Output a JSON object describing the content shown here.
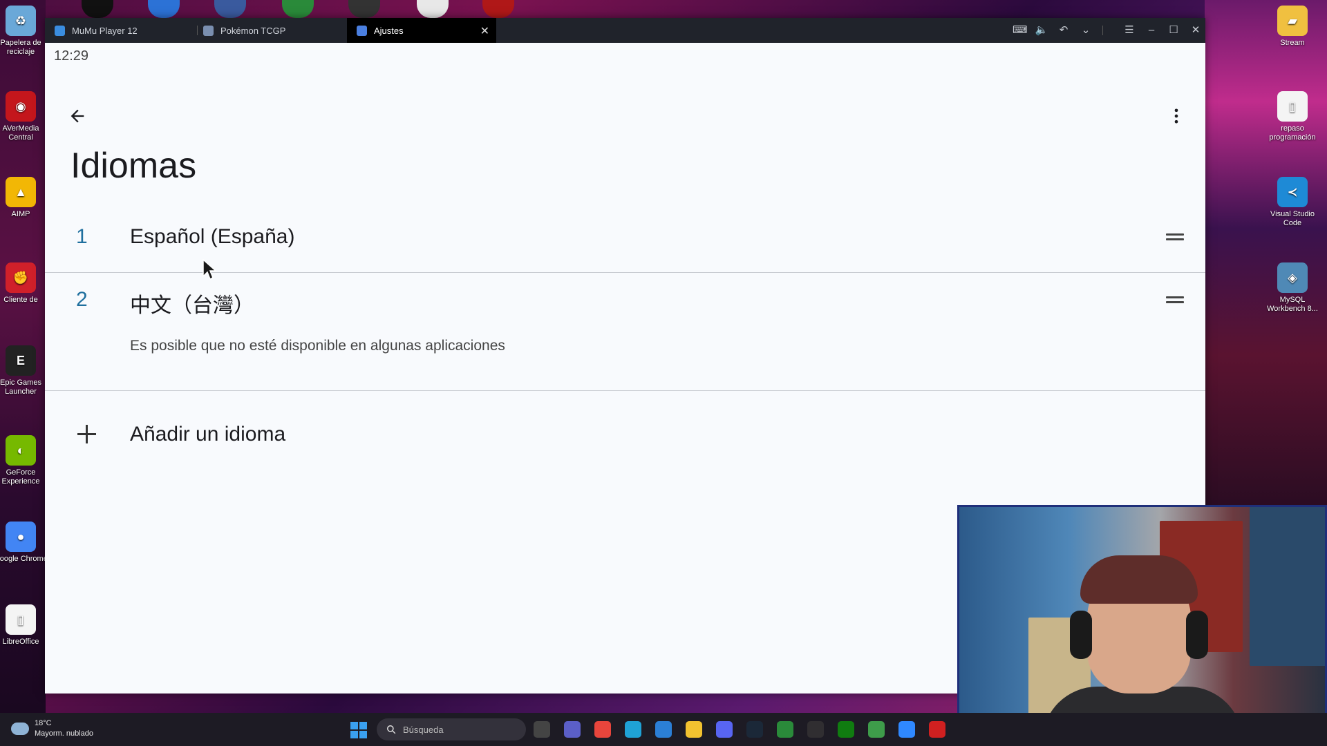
{
  "desktop": {
    "left_icons": [
      {
        "label": "Papelera de reciclaje",
        "color": "#6aa8d8",
        "glyph": "♻"
      },
      {
        "label": "AVerMedia Central",
        "color": "#c4161c",
        "glyph": "◉"
      },
      {
        "label": "AIMP",
        "color": "#f2b705",
        "glyph": "▲"
      },
      {
        "label": "Cliente de",
        "color": "#d0202a",
        "glyph": "✊"
      },
      {
        "label": "Epic Games Launcher",
        "color": "#222222",
        "glyph": "E"
      },
      {
        "label": "GeForce Experience",
        "color": "#76b900",
        "glyph": "◐"
      },
      {
        "label": "Google Chrome",
        "color": "#4285f4",
        "glyph": "●"
      },
      {
        "label": "LibreOffice",
        "color": "#f4f4f4",
        "glyph": "▯"
      }
    ],
    "right_icons": [
      {
        "label": "Stream",
        "color": "#f0c040",
        "glyph": "▰"
      },
      {
        "label": "repaso programación",
        "color": "#f4f4f4",
        "glyph": "▯"
      },
      {
        "label": "Visual Studio Code",
        "color": "#1e8ad6",
        "glyph": "≺"
      },
      {
        "label": "MySQL Workbench 8...",
        "color": "#4f89b6",
        "glyph": "◈"
      }
    ]
  },
  "window": {
    "tabs": [
      {
        "label": "MuMu Player 12",
        "color": "#3a8de0"
      },
      {
        "label": "Pokémon TCGP",
        "color": "#7a8fb0"
      },
      {
        "label": "Ajustes",
        "color": "#4a7fe0"
      }
    ],
    "close_glyph": "✕"
  },
  "android": {
    "clock": "12:29",
    "title": "Idiomas",
    "languages": [
      {
        "number": "1",
        "name": "Español (España)",
        "note": ""
      },
      {
        "number": "2",
        "name": "中文（台灣）",
        "note": "Es posible que no esté disponible en algunas aplicaciones"
      }
    ],
    "add_label": "Añadir un idioma"
  },
  "taskbar": {
    "temperature": "18°C",
    "weather": "Mayorm. nublado",
    "search_placeholder": "Búsqueda",
    "apps": [
      {
        "name": "file-explorer-dark-app",
        "color": "#444444"
      },
      {
        "name": "teams-app",
        "color": "#5b5fc7"
      },
      {
        "name": "chrome-app",
        "color": "#e8453c"
      },
      {
        "name": "edge-app",
        "color": "#1fa2d6"
      },
      {
        "name": "store-app",
        "color": "#2b7fd6"
      },
      {
        "name": "folder-app",
        "color": "#f2c230"
      },
      {
        "name": "discord-app",
        "color": "#5865f2"
      },
      {
        "name": "steam-app",
        "color": "#1b2838"
      },
      {
        "name": "terminal-app",
        "color": "#2a8a3a"
      },
      {
        "name": "obs-app",
        "color": "#302e31"
      },
      {
        "name": "xbox-app",
        "color": "#107c10"
      },
      {
        "name": "chrome-profile-app",
        "color": "#3e9c4a"
      },
      {
        "name": "mumu-app",
        "color": "#2f88ff"
      },
      {
        "name": "red-app",
        "color": "#d02020"
      }
    ]
  }
}
